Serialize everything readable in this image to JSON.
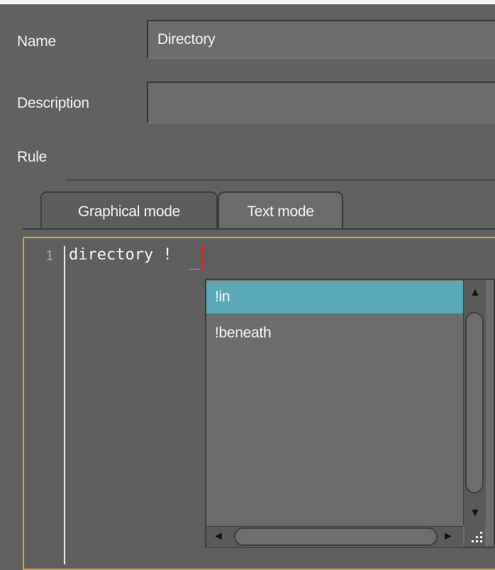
{
  "form": {
    "name_label": "Name",
    "name_value": "Directory",
    "description_label": "Description",
    "description_value": "",
    "rule_label": "Rule"
  },
  "tabs": [
    {
      "label": "Graphical mode",
      "active": false
    },
    {
      "label": "Text mode",
      "active": true
    }
  ],
  "editor": {
    "line_number": "1",
    "code": "directory !"
  },
  "autocomplete": {
    "items": [
      {
        "label": "!in",
        "selected": true
      },
      {
        "label": "!beneath",
        "selected": false
      }
    ]
  },
  "colors": {
    "background": "#616161",
    "selection": "#5aa9b8",
    "editor_border": "#c8a43c",
    "cursor": "#e2231a"
  },
  "icons": [
    "scroll-up-arrow-icon",
    "scroll-down-arrow-icon",
    "scroll-left-arrow-icon",
    "scroll-right-arrow-icon",
    "resize-grip-icon"
  ]
}
